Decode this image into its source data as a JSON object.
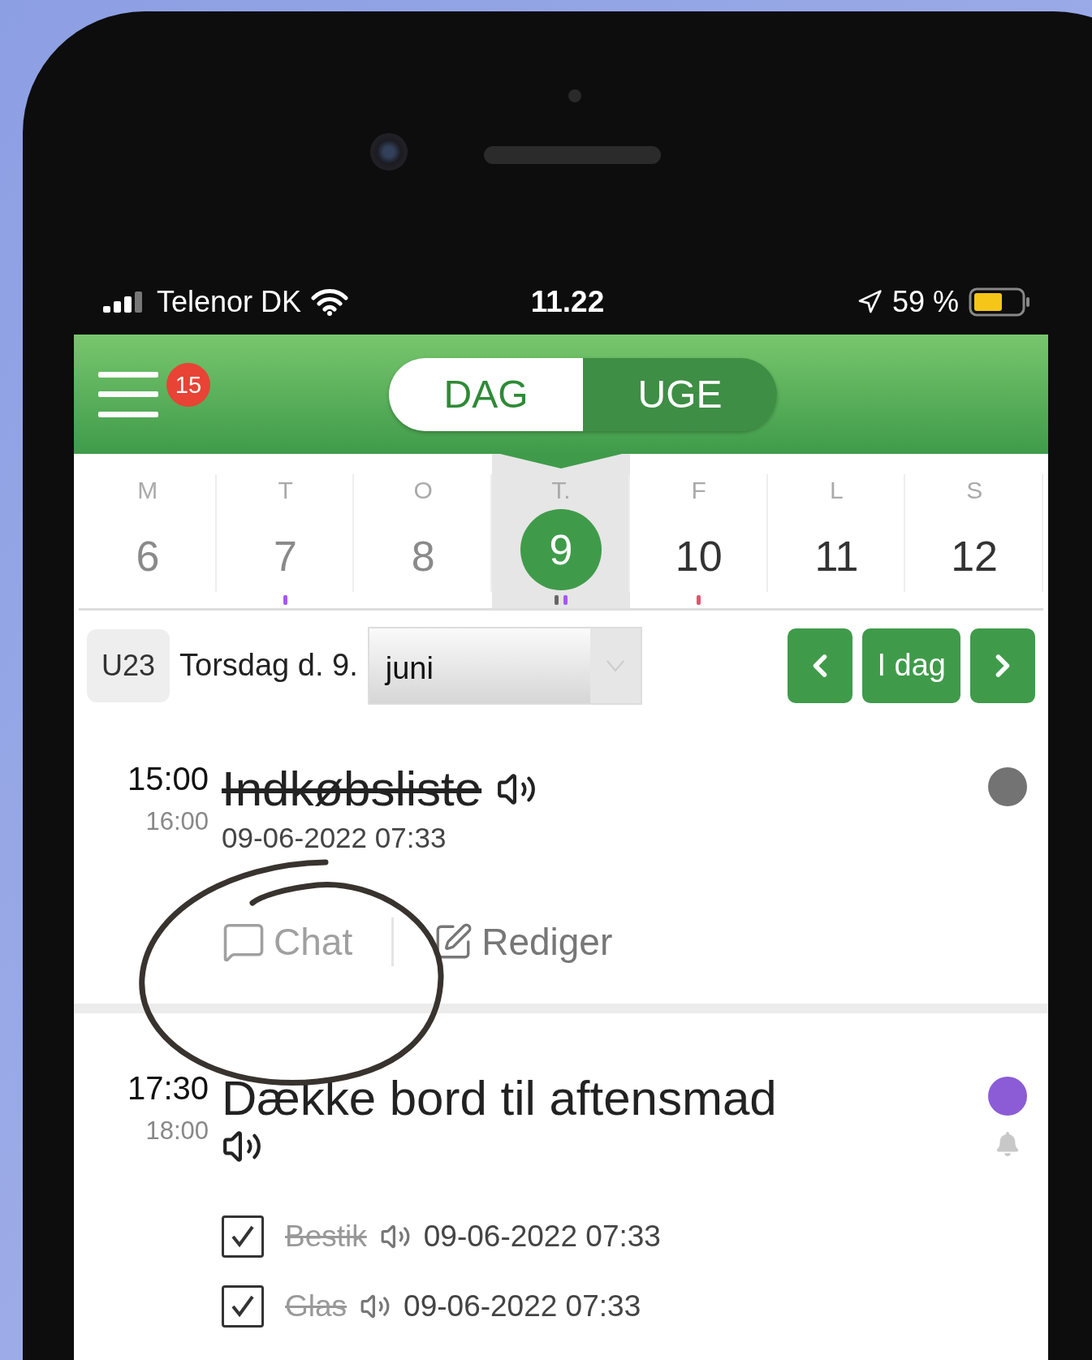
{
  "status_bar": {
    "carrier": "Telenor DK",
    "time": "11.22",
    "battery": "59 %"
  },
  "header": {
    "notification_count": "15",
    "view_tabs": [
      {
        "label": "DAG",
        "selected": true
      },
      {
        "label": "UGE",
        "selected": false
      }
    ]
  },
  "week_strip": {
    "days": [
      {
        "letter": "M",
        "date": "6",
        "past": true,
        "selected": false
      },
      {
        "letter": "T",
        "date": "7",
        "past": true,
        "selected": false,
        "markers": [
          {
            "color": "#a855f7"
          }
        ]
      },
      {
        "letter": "O",
        "date": "8",
        "past": true,
        "selected": false
      },
      {
        "letter": "T.",
        "date": "9",
        "past": false,
        "selected": true,
        "markers": [
          {
            "color": "#666666"
          },
          {
            "color": "#a855f7"
          }
        ]
      },
      {
        "letter": "F",
        "date": "10",
        "past": false,
        "selected": false,
        "markers": [
          {
            "color": "#e0556a"
          }
        ]
      },
      {
        "letter": "L",
        "date": "11",
        "past": false,
        "selected": false
      },
      {
        "letter": "S",
        "date": "12",
        "past": false,
        "selected": false
      }
    ]
  },
  "date_bar": {
    "week": "U23",
    "date_label": "Torsdag d. 9.",
    "month_select": {
      "value": "juni"
    },
    "today_button": "I dag"
  },
  "events": [
    {
      "start": "15:00",
      "end": "16:00",
      "title": "Indkøbsliste",
      "done": true,
      "timestamp": "09-06-2022 07:33",
      "color": "#737373",
      "actions": [
        {
          "kind": "chat",
          "label": "Chat",
          "disabled": true
        },
        {
          "kind": "edit",
          "label": "Rediger",
          "disabled": false
        }
      ]
    },
    {
      "start": "17:30",
      "end": "18:00",
      "title": "Dække bord til aftensmad",
      "done": false,
      "color": "#8b5cd6",
      "reminder": true,
      "checklist": [
        {
          "label": "Bestik",
          "checked": true,
          "timestamp": "09-06-2022 07:33"
        },
        {
          "label": "Glas",
          "checked": true,
          "timestamp": "09-06-2022 07:33"
        }
      ]
    }
  ]
}
